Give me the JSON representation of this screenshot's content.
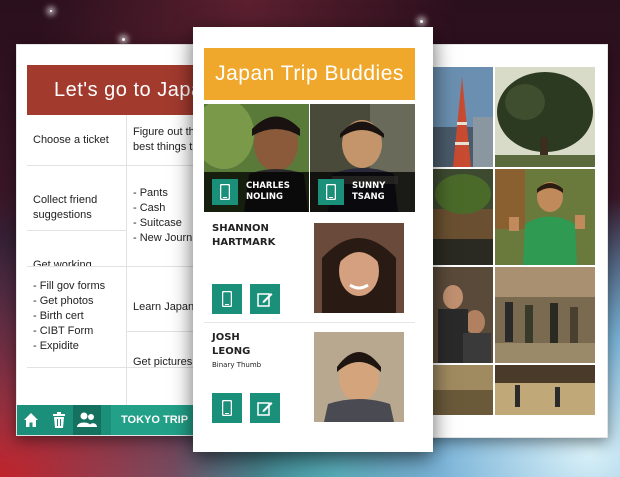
{
  "left_card": {
    "title": "Let's go to Japan",
    "rows": [
      {
        "c1": "Choose a ticket",
        "c2": "Figure out the\nbest things t"
      },
      {
        "c1": "Collect friend\nsuggestions",
        "c2": "- Pants\n- Cash\n- Suitcase\n- New Journ"
      },
      {
        "c1": "Get working\npassport",
        "c2": ""
      },
      {
        "c1": "- Fill gov forms\n- Get photos\n- Birth cert\n- CIBT Form\n- Expidite",
        "c2": "Learn Japan"
      },
      {
        "c1": "",
        "c2": "Get pictures\nSunny."
      }
    ],
    "toolbar_label": "TOKYO TRIP"
  },
  "middle_card": {
    "title": "Japan Trip Buddies",
    "top_people": [
      {
        "name": "CHARLES\nNOLING"
      },
      {
        "name": "SUNNY\nTSANG"
      }
    ],
    "people": [
      {
        "name": "SHANNON\nHARTMARK",
        "sub": ""
      },
      {
        "name": "JOSH\nLEONG",
        "sub": "Binary Thumb"
      }
    ]
  },
  "colors": {
    "left_header": "#a23a2e",
    "mid_header": "#f0a82c",
    "teal": "#1a8f7a"
  }
}
